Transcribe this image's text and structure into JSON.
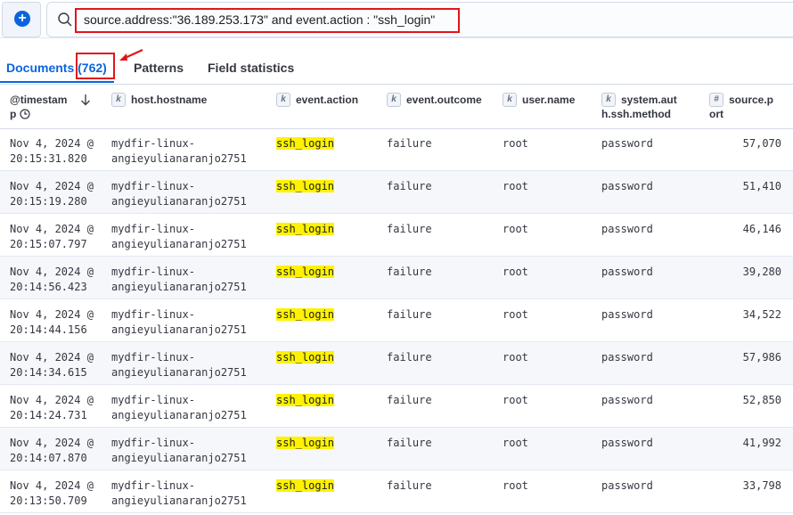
{
  "query": {
    "text": "source.address:\"36.189.253.173\" and event.action : \"ssh_login\""
  },
  "tabs": {
    "documents": "Documents",
    "count": "(762)",
    "patterns": "Patterns",
    "field_statistics": "Field statistics"
  },
  "columns": {
    "timestamp_a": "@timestam",
    "timestamp_b": "p",
    "hostname": "host.hostname",
    "action": "event.action",
    "outcome": "event.outcome",
    "user": "user.name",
    "ssh_a": "system.aut",
    "ssh_b": "h.ssh.method",
    "port_a": "source.p",
    "port_b": "ort"
  },
  "field_type_keyword": "k",
  "field_type_number": "#",
  "rows": [
    {
      "date": "Nov 4, 2024 @",
      "time": "20:15:31.820",
      "host1": "mydfir-linux-",
      "host2": "angieyulianaranjo2751",
      "action": "ssh_login",
      "outcome": "failure",
      "user": "root",
      "method": "password",
      "port": "57,070"
    },
    {
      "date": "Nov 4, 2024 @",
      "time": "20:15:19.280",
      "host1": "mydfir-linux-",
      "host2": "angieyulianaranjo2751",
      "action": "ssh_login",
      "outcome": "failure",
      "user": "root",
      "method": "password",
      "port": "51,410"
    },
    {
      "date": "Nov 4, 2024 @",
      "time": "20:15:07.797",
      "host1": "mydfir-linux-",
      "host2": "angieyulianaranjo2751",
      "action": "ssh_login",
      "outcome": "failure",
      "user": "root",
      "method": "password",
      "port": "46,146"
    },
    {
      "date": "Nov 4, 2024 @",
      "time": "20:14:56.423",
      "host1": "mydfir-linux-",
      "host2": "angieyulianaranjo2751",
      "action": "ssh_login",
      "outcome": "failure",
      "user": "root",
      "method": "password",
      "port": "39,280"
    },
    {
      "date": "Nov 4, 2024 @",
      "time": "20:14:44.156",
      "host1": "mydfir-linux-",
      "host2": "angieyulianaranjo2751",
      "action": "ssh_login",
      "outcome": "failure",
      "user": "root",
      "method": "password",
      "port": "34,522"
    },
    {
      "date": "Nov 4, 2024 @",
      "time": "20:14:34.615",
      "host1": "mydfir-linux-",
      "host2": "angieyulianaranjo2751",
      "action": "ssh_login",
      "outcome": "failure",
      "user": "root",
      "method": "password",
      "port": "57,986"
    },
    {
      "date": "Nov 4, 2024 @",
      "time": "20:14:24.731",
      "host1": "mydfir-linux-",
      "host2": "angieyulianaranjo2751",
      "action": "ssh_login",
      "outcome": "failure",
      "user": "root",
      "method": "password",
      "port": "52,850"
    },
    {
      "date": "Nov 4, 2024 @",
      "time": "20:14:07.870",
      "host1": "mydfir-linux-",
      "host2": "angieyulianaranjo2751",
      "action": "ssh_login",
      "outcome": "failure",
      "user": "root",
      "method": "password",
      "port": "41,992"
    },
    {
      "date": "Nov 4, 2024 @",
      "time": "20:13:50.709",
      "host1": "mydfir-linux-",
      "host2": "angieyulianaranjo2751",
      "action": "ssh_login",
      "outcome": "failure",
      "user": "root",
      "method": "password",
      "port": "33,798"
    }
  ],
  "colors": {
    "accent": "#0b64dd",
    "annotation": "#e0161c",
    "highlight": "#fff200"
  }
}
